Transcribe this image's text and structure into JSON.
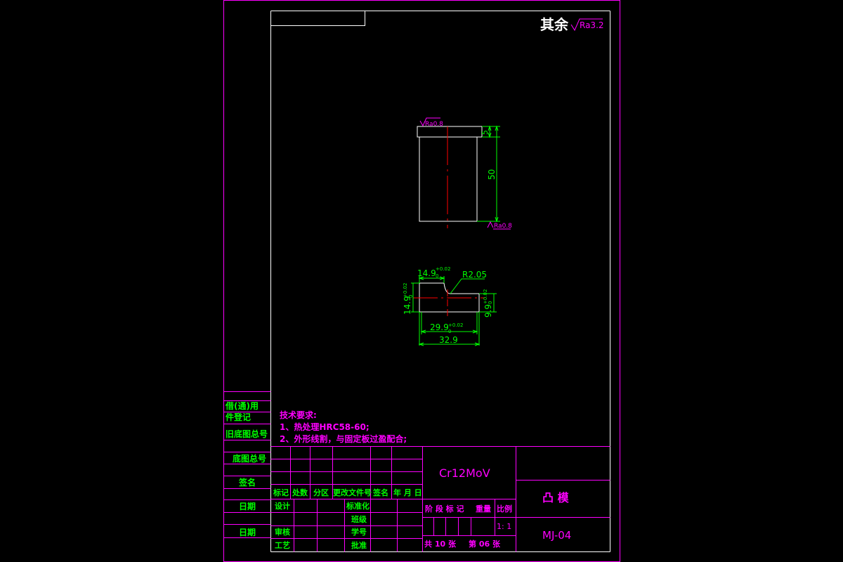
{
  "colors": {
    "background": "#000000",
    "frame": "#ff00ff",
    "part": "#ffffff",
    "centerline": "#ff0000",
    "dimension": "#00ff00",
    "surface_symbol": "#ff00ff",
    "title_text_green": "#00ff00",
    "title_text_magenta": "#ff00ff",
    "text_white": "#ffffff"
  },
  "corner_note": {
    "prefix": "其余",
    "roughness": "Ra3.2"
  },
  "front_view": {
    "roughness_top": "Ra0.8",
    "roughness_bottom": "Ra0.8",
    "dim_step": "5",
    "dim_height": "50"
  },
  "top_view": {
    "dim_top_width": "14.9",
    "dim_top_width_tol_upper": "+0.02",
    "dim_top_width_tol_lower": "0",
    "dim_radius": "R2.05",
    "dim_left_height": "14.9",
    "dim_left_height_tol_upper": "+0.02",
    "dim_left_height_tol_lower": "0",
    "dim_right_height": "9.9",
    "dim_right_height_tol_upper": "+0.02",
    "dim_right_height_tol_lower": "0",
    "dim_inner_width": "29.9",
    "dim_inner_width_tol_upper": "+0.02",
    "dim_inner_width_tol_lower": "0",
    "dim_total_width": "32.9"
  },
  "tech_notes": {
    "heading": "技术要求:",
    "line1": "1、热处理HRC58-60;",
    "line2": "2、外形线割，与固定板过盈配合;"
  },
  "side_labels": [
    "借(通)用",
    "件登记",
    "旧底图总号",
    "底图总号",
    "签名",
    "日期",
    "日期"
  ],
  "title_block": {
    "material": "Cr12MoV",
    "part_name": "凸 模",
    "drawing_no": "MJ-04",
    "revision_header": [
      "标记",
      "处数",
      "分区",
      "更改文件号",
      "签名",
      "年 月 日"
    ],
    "left_labels": [
      "设计",
      "审核",
      "工艺"
    ],
    "mid_labels": [
      "标准化",
      "班级",
      "学号",
      "批准"
    ],
    "stage_header": [
      "阶 段 标 记",
      "重量",
      "比例"
    ],
    "scale": "1: 1",
    "sheets_total": "共 10 张",
    "sheet_no": "第 06 张"
  }
}
